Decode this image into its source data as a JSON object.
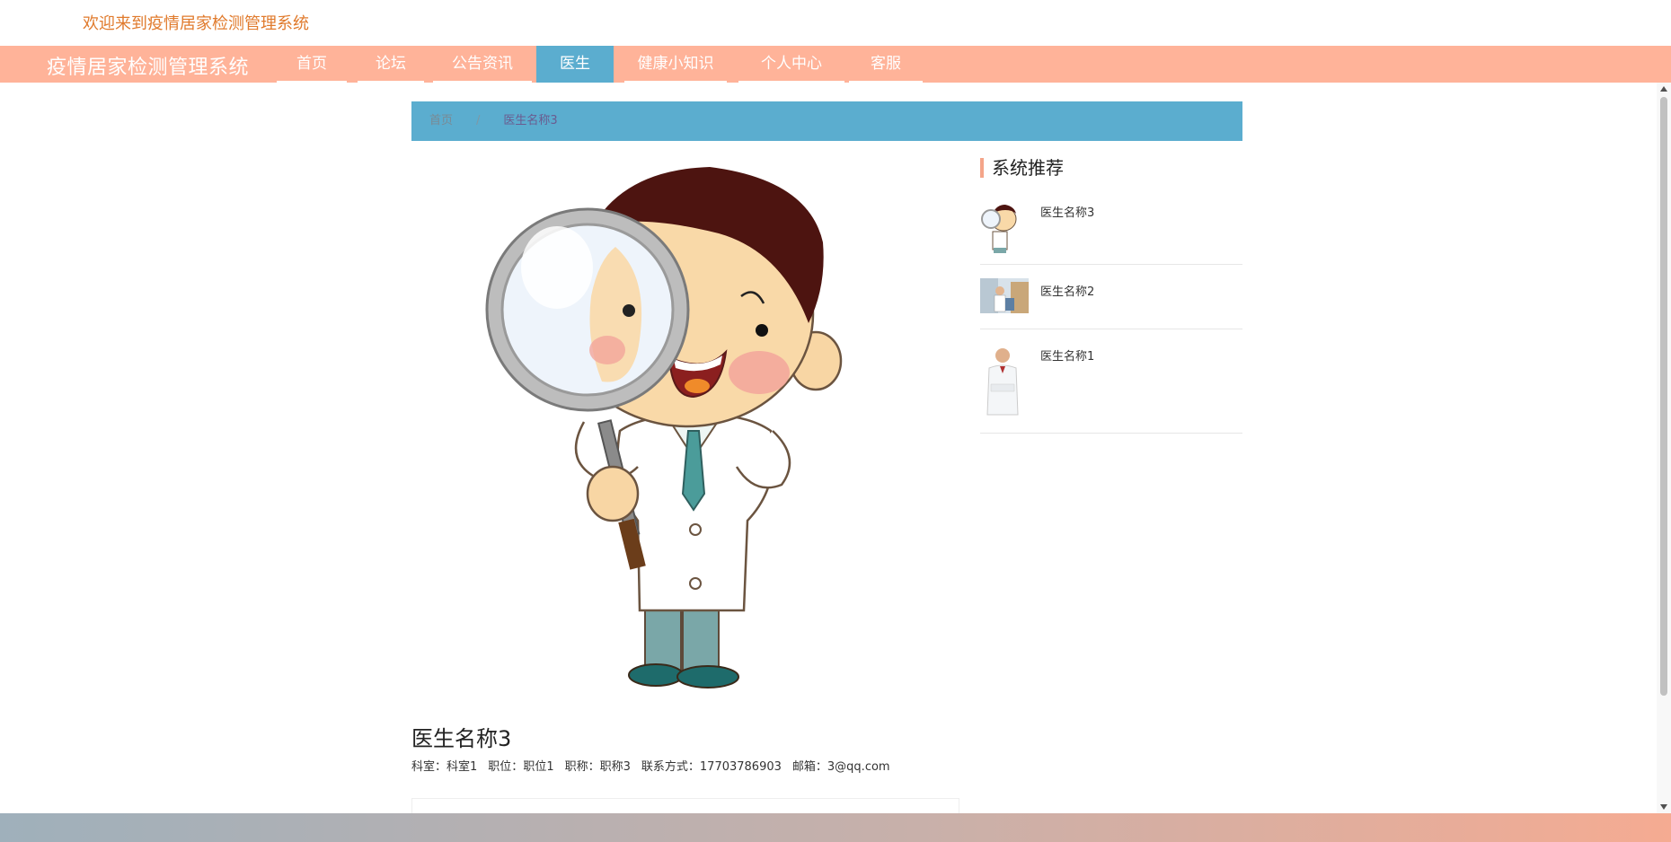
{
  "header": {
    "welcome": "欢迎来到疫情居家检测管理系统",
    "brand": "疫情居家检测管理系统"
  },
  "nav": {
    "items": [
      {
        "label": "首页",
        "active": false
      },
      {
        "label": "论坛",
        "active": false
      },
      {
        "label": "公告资讯",
        "active": false
      },
      {
        "label": "医生",
        "active": true
      },
      {
        "label": "健康小知识",
        "active": false
      },
      {
        "label": "个人中心",
        "active": false
      },
      {
        "label": "客服",
        "active": false
      }
    ]
  },
  "breadcrumb": {
    "home": "首页",
    "separator": "/",
    "current": "医生名称3"
  },
  "sidebar": {
    "title": "系统推荐",
    "items": [
      {
        "name": "医生名称3",
        "thumb": "cartoon-doctor-magnifier"
      },
      {
        "name": "医生名称2",
        "thumb": "doctor-photo-clinic"
      },
      {
        "name": "医生名称1",
        "thumb": "doctor-photo-portrait"
      }
    ]
  },
  "detail": {
    "name": "医生名称3",
    "department_label": "科室：",
    "department": "科室1",
    "position_label": "职位：",
    "position": "职位1",
    "title_label": "职称：",
    "title": "职称3",
    "contact_label": "联系方式：",
    "contact": "17703786903",
    "email_label": "邮箱：",
    "email": "3@qq.com"
  },
  "colors": {
    "navbar": "#ffb399",
    "accent_blue": "#5badcf",
    "welcome_text": "#e07a2c"
  }
}
